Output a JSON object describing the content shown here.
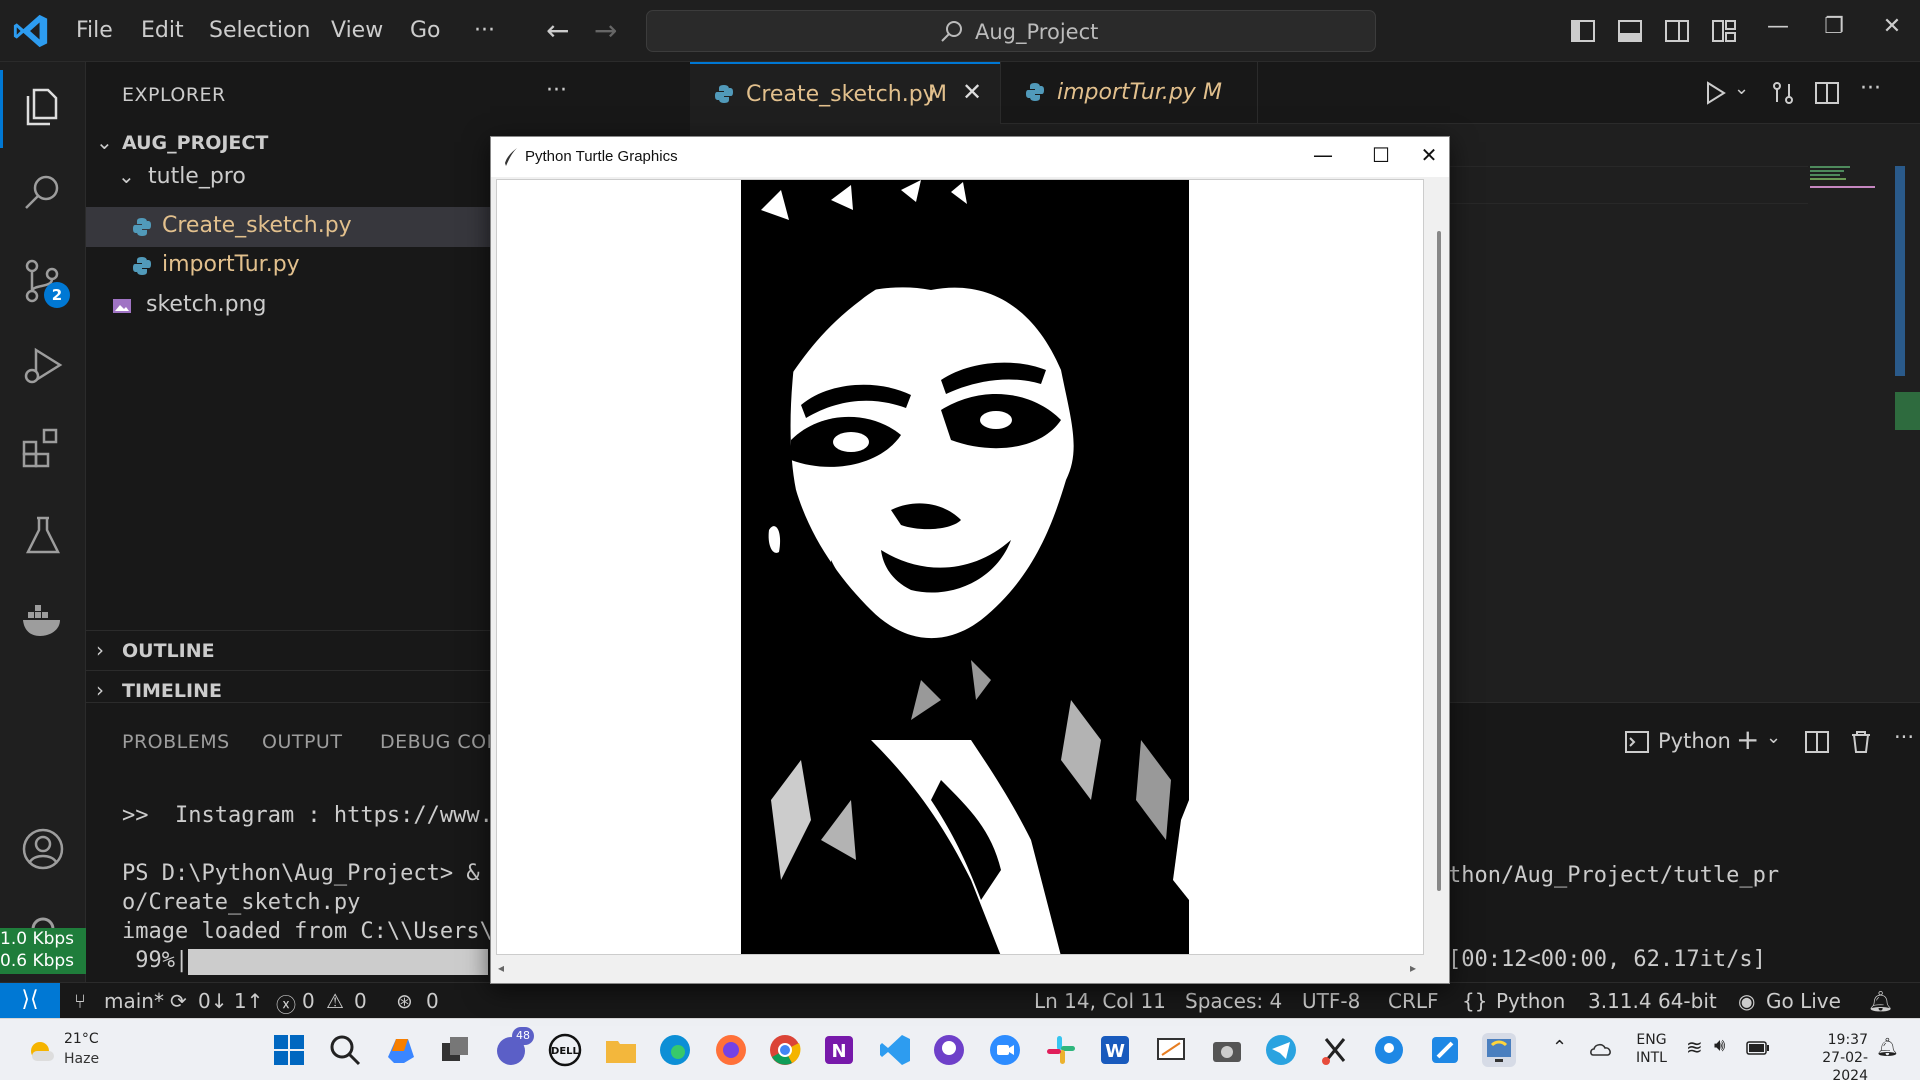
{
  "titlebar": {
    "menus": [
      "File",
      "Edit",
      "Selection",
      "View",
      "Go",
      "···"
    ],
    "search_text": "Aug_Project",
    "icons": {
      "back": "arrow-left-icon",
      "forward": "arrow-right-icon",
      "search": "search-icon"
    }
  },
  "sidebar": {
    "title": "EXPLORER",
    "more": "···",
    "project": "AUG_PROJECT",
    "folder": "tutle_pro",
    "files": [
      "Create_sketch.py",
      "importTur.py"
    ],
    "root_files": [
      "sketch.png"
    ],
    "outline": "OUTLINE",
    "timeline": "TIMELINE"
  },
  "activity": {
    "scm_badge": "2",
    "net_down": "1.0 Kbps",
    "net_up": "0.6 Kbps"
  },
  "editor": {
    "tabs": [
      {
        "name": "Create_sketch.py",
        "status": "M",
        "active": true
      },
      {
        "name": "importTur.py",
        "status": "M",
        "active": false
      }
    ]
  },
  "panel": {
    "tabs": [
      "PROBLEMS",
      "OUTPUT",
      "DEBUG CON"
    ],
    "terminal_name": "Python",
    "terminal_lines": [
      ">>  Instagram : https://www.i",
      "",
      "PS D:\\Python\\Aug_Project> & (",
      "o/Create_sketch.py",
      "image loaded from C:\\\\Users\\",
      " 99%|"
    ],
    "term_right_1": "thon/Aug_Project/tutle_pr",
    "term_right_2": "[00:12<00:00, 62.17it/s]",
    "progress_fraction": 0.99
  },
  "statusbar": {
    "branch": "main*",
    "sync": "0↓ 1↑",
    "errors": "0",
    "warnings": "0",
    "ports": "0",
    "position": "Ln 14, Col 11",
    "spaces": "Spaces: 4",
    "encoding": "UTF-8",
    "eol": "CRLF",
    "language": "Python",
    "interpreter": "3.11.4 64-bit",
    "golive": "Go Live"
  },
  "turtle": {
    "title": "Python Turtle Graphics"
  },
  "taskbar": {
    "temp": "21°C",
    "weather": "Haze",
    "teams_badge": "48",
    "lang_1": "ENG",
    "lang_2": "INTL",
    "time": "19:37",
    "date": "27-02-2024"
  },
  "colors": {
    "accent": "#0078d4",
    "modified": "#e2c08d",
    "net_speed_bg": "#1f7d3b"
  }
}
